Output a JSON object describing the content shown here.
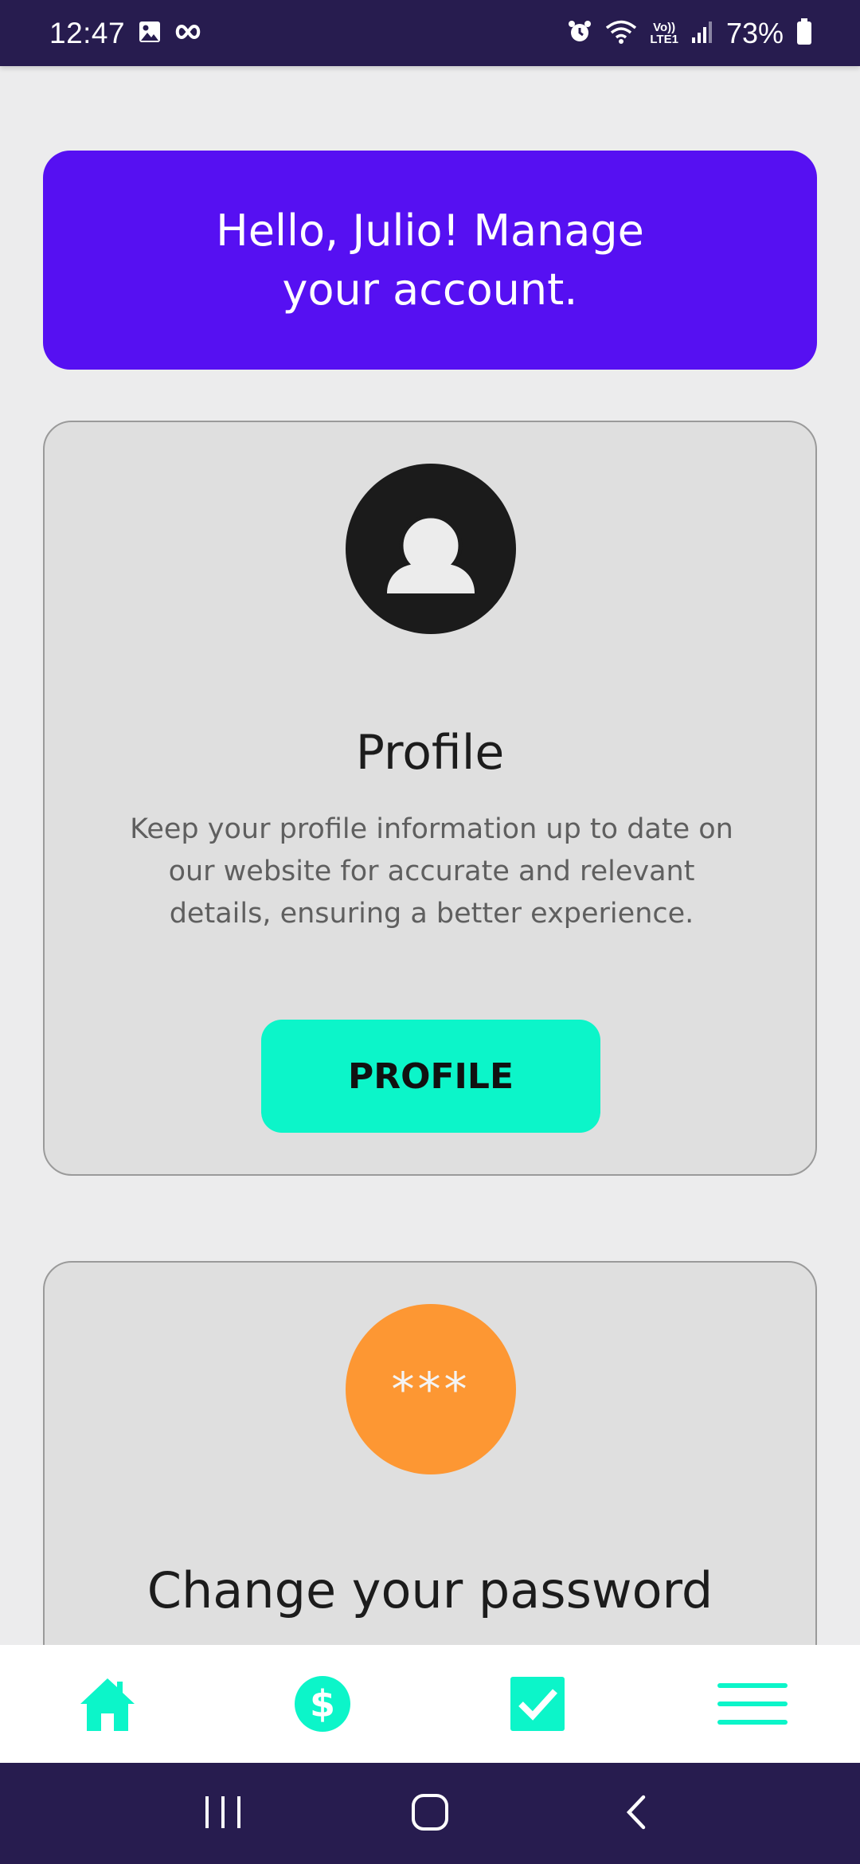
{
  "status_bar": {
    "time": "12:47",
    "battery": "73%",
    "network_label_top": "Vo))",
    "network_label_bottom": "LTE1",
    "icons": [
      "gallery-icon",
      "infinity-icon",
      "alarm-icon",
      "wifi-icon",
      "signal-icon",
      "battery-icon"
    ]
  },
  "greeting": {
    "text": "Hello, Julio! Manage your account."
  },
  "profile_card": {
    "icon": "user-avatar-icon",
    "title": "Profile",
    "description": "Keep your profile information up to date on our website for accurate and relevant details, ensuring a better experience.",
    "button_label": "PROFILE"
  },
  "password_card": {
    "icon_text": "***",
    "title": "Change your password"
  },
  "bottom_nav": {
    "items": [
      "home-icon",
      "dollar-icon",
      "checkbox-icon",
      "menu-icon"
    ]
  },
  "colors": {
    "status_bar": "#271c4f",
    "greeting_bg": "#5610f2",
    "accent": "#0cf5c9",
    "password_circle": "#fd9733",
    "card_bg": "#dfdfdf"
  }
}
